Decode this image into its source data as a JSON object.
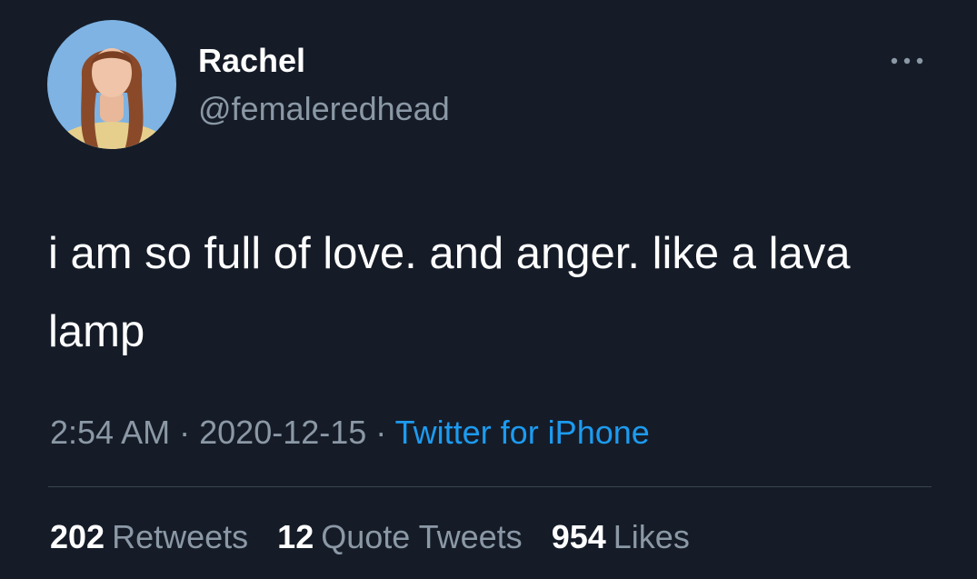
{
  "user": {
    "display_name": "Rachel",
    "handle": "@femaleredhead",
    "avatar_icon": "profile-photo"
  },
  "more_icon": "more-horizontal-icon",
  "tweet": {
    "text": "i am so full of love. and anger. like a lava lamp",
    "time": "2:54 AM",
    "separator": "·",
    "date": "2020-12-15",
    "source": "Twitter for iPhone"
  },
  "stats": {
    "retweets_count": "202",
    "retweets_label": "Retweets",
    "quotes_count": "12",
    "quotes_label": "Quote Tweets",
    "likes_count": "954",
    "likes_label": "Likes"
  },
  "colors": {
    "background": "#151c28",
    "text_primary": "#ffffff",
    "text_secondary": "#8b98a5",
    "link": "#1d9bf0",
    "divider": "#38444d"
  }
}
